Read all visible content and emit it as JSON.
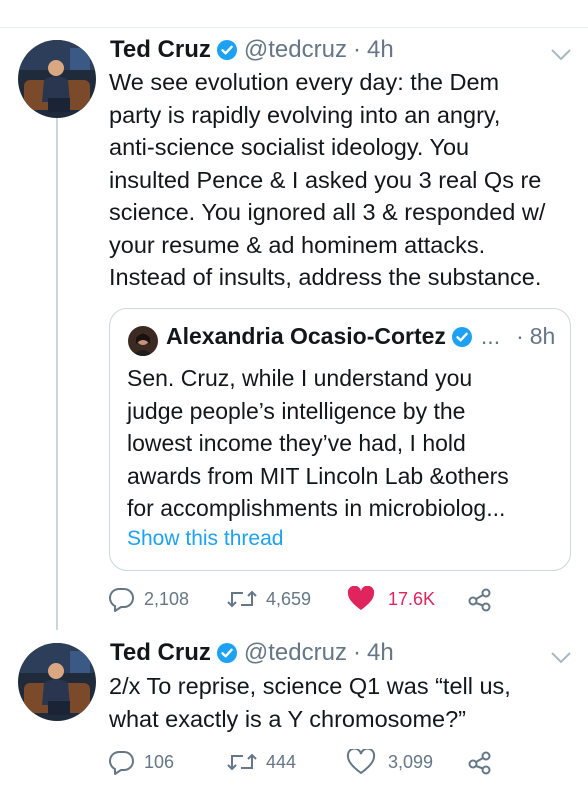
{
  "tweets": [
    {
      "name": "Ted Cruz",
      "handle": "@tedcruz",
      "separator": "·",
      "time": "4h",
      "text": "We see evolution every day: the Dem\nparty is rapidly evolving into an angry,\nanti-science socialist ideology. You\ninsulted Pence & I asked you 3 real Qs re\nscience. You ignored all 3 & responded w/\nyour resume & ad hominem attacks.\nInstead of insults, address the substance.",
      "quote": {
        "name": "Alexandria Ocasio-Cortez",
        "ellipsis": "...",
        "separator": "·",
        "time": "8h",
        "text": "Sen. Cruz, while I understand you\njudge people’s intelligence by the\nlowest income they’ve had, I hold\nawards from MIT Lincoln Lab &others\nfor accomplishments in microbiolog...",
        "link": "Show this thread"
      },
      "actions": {
        "replies": "2,108",
        "retweets": "4,659",
        "likes": "17.6K"
      },
      "liked": true
    },
    {
      "name": "Ted Cruz",
      "handle": "@tedcruz",
      "separator": "·",
      "time": "4h",
      "text": "2/x To reprise, science Q1 was “tell us,\nwhat exactly is a Y chromosome?”",
      "actions": {
        "replies": "106",
        "retweets": "444",
        "likes": "3,099"
      },
      "liked": false
    }
  ],
  "colors": {
    "text": "#14171a",
    "secondary": "#657786",
    "link": "#1da1f2",
    "like": "#e0245e",
    "border": "#ccd6dd"
  },
  "icons": [
    "verified-icon",
    "chevron-down-icon",
    "reply-icon",
    "retweet-icon",
    "heart-icon",
    "share-icon"
  ]
}
